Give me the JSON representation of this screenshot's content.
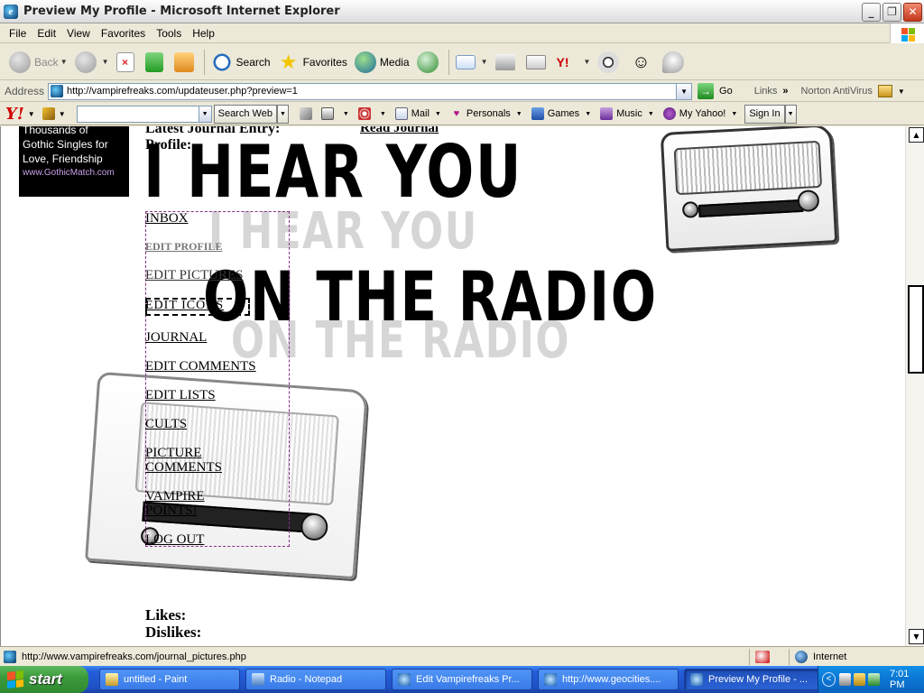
{
  "window": {
    "title": "Preview My Profile - Microsoft Internet Explorer",
    "buttons": {
      "minimize": "_",
      "maximize": "❐",
      "close": "✕"
    }
  },
  "menu": [
    "File",
    "Edit",
    "View",
    "Favorites",
    "Tools",
    "Help"
  ],
  "toolbar": {
    "back": "Back",
    "search": "Search",
    "favorites": "Favorites",
    "media": "Media"
  },
  "address": {
    "label": "Address",
    "url": "http://vampirefreaks.com/updateuser.php?preview=1",
    "go": "Go",
    "links": "Links",
    "links_chevron": "»",
    "norton": "Norton AntiVirus"
  },
  "yahoo_toolbar": {
    "logo": "Y!",
    "search_placeholder": "",
    "search_button": "Search Web",
    "items": [
      "Mail",
      "Personals",
      "Games",
      "Music",
      "My Yahoo!"
    ],
    "sign_in": "Sign In"
  },
  "page": {
    "ad": {
      "lines": [
        "Thousands of",
        "Gothic Singles for",
        "Love, Friendship"
      ],
      "link": "www.GothicMatch.com"
    },
    "latest_journal": "Latest Journal Entry:",
    "read_journal": "Read Journal",
    "profile_label": "Profile:",
    "banner_line1": "I HEAR YOU",
    "banner_line2": "ON THE RADIO",
    "ghost_line1": "I HEAR YOU",
    "ghost_line2": "ON THE RADIO",
    "nav": [
      "INBOX",
      "EDIT PROFILE",
      "EDIT PICTURES",
      "EDIT ICONS",
      "JOURNAL",
      "EDIT COMMENTS",
      "EDIT LISTS",
      "CULTS",
      "PICTURE COMMENTS",
      "VAMPIRE POINTS!",
      "LOG OUT"
    ],
    "likes_label": "Likes:",
    "dislikes_label": "Dislikes:"
  },
  "status": {
    "text": "http://www.vampirefreaks.com/journal_pictures.php",
    "zone": "Internet"
  },
  "taskbar": {
    "start": "start",
    "tasks": [
      "untitled - Paint",
      "Radio - Notepad",
      "Edit Vampirefreaks Pr...",
      "http://www.geocities....",
      "Preview My Profile - ..."
    ],
    "clock": "7:01 PM",
    "tray_chevron": "<"
  }
}
